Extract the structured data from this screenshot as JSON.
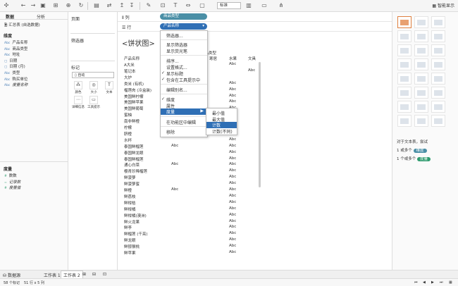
{
  "toolbar": {
    "view_size": "标准",
    "smart_show": "智能显示"
  },
  "left": {
    "tab_data": "数据",
    "tab_analysis": "分析",
    "datasource": "汇总表 (自选数据)",
    "dimensions_header": "维度",
    "dimensions": [
      {
        "type": "Abc",
        "name": "产品名称"
      },
      {
        "type": "Abc",
        "name": "商品类型"
      },
      {
        "type": "Abc",
        "name": "地址"
      },
      {
        "type": "▢",
        "name": "日期"
      },
      {
        "type": "▢",
        "name": "日期 (月)"
      },
      {
        "type": "Abc",
        "name": "类型"
      },
      {
        "type": "Abc",
        "name": "购买单位"
      },
      {
        "type": "Abc",
        "name": "度量名称"
      }
    ],
    "measures_header": "度量",
    "measures": [
      {
        "type": "#",
        "name": "数数"
      },
      {
        "type": "=",
        "name": "记录数"
      },
      {
        "type": "#",
        "name": "度量值"
      }
    ]
  },
  "pages": {
    "pages_label": "页面",
    "filters_label": "筛选器",
    "marks_label": "标记",
    "mark_type": "自动",
    "mark_buttons": [
      "颜色",
      "大小",
      "文本",
      "详细信息",
      "工具提示"
    ]
  },
  "shelves": {
    "columns_label": "列",
    "rows_label": "行",
    "columns_pill": "商品类型",
    "rows_pill": "产品名称"
  },
  "view": {
    "title": "<饼状图>",
    "col_header_group": "商品类型",
    "row_header": "产品名称",
    "col_headers": [
      "寒居",
      "水果",
      "文具"
    ],
    "rows": [
      {
        "name": "A大米",
        "c1": "",
        "c2": "Abc",
        "c3": ""
      },
      {
        "name": "笔记本",
        "c1": "",
        "c2": "",
        "c3": "Abc"
      },
      {
        "name": "大炉",
        "c1": "",
        "c2": "",
        "c3": ""
      },
      {
        "name": "类米 (有机)",
        "c1": "",
        "c2": "Abc",
        "c3": ""
      },
      {
        "name": "榴莲肉 (冷盒装)",
        "c1": "",
        "c2": "Abc",
        "c3": ""
      },
      {
        "name": "美国鲜柠檬",
        "c1": "",
        "c2": "Abc",
        "c3": ""
      },
      {
        "name": "美国鲜苹果",
        "c1": "",
        "c2": "Abc",
        "c3": ""
      },
      {
        "name": "美国鲜葡萄",
        "c1": "",
        "c2": "Abc",
        "c3": ""
      },
      {
        "name": "蜜柚",
        "c1": "",
        "c2": "Abc",
        "c3": ""
      },
      {
        "name": "南非鲜橙",
        "c1": "",
        "c2": "Abc",
        "c3": ""
      },
      {
        "name": "柠檬",
        "c1": "",
        "c2": "Abc",
        "c3": ""
      },
      {
        "name": "脐橙",
        "c1": "",
        "c2": "Abc",
        "c3": ""
      },
      {
        "name": "水杯",
        "c1": "",
        "c2": "Abc",
        "c3": ""
      },
      {
        "name": "泰国鲜榴莲",
        "c1": "Abc",
        "c2": "Abc",
        "c3": ""
      },
      {
        "name": "泰国鲜龙眼",
        "c1": "",
        "c2": "Abc",
        "c3": ""
      },
      {
        "name": "泰国鲜榴莲",
        "c1": "",
        "c2": "Abc",
        "c3": ""
      },
      {
        "name": "通心白菜",
        "c1": "Abc",
        "c2": "Abc",
        "c3": ""
      },
      {
        "name": "樱青珍稀榴莲",
        "c1": "",
        "c2": "Abc",
        "c3": ""
      },
      {
        "name": "鲜菠萝",
        "c1": "",
        "c2": "Abc",
        "c3": ""
      },
      {
        "name": "鲜菠萝蜜",
        "c1": "",
        "c2": "Abc",
        "c3": ""
      },
      {
        "name": "鲜橙",
        "c1": "Abc",
        "c2": "Abc",
        "c3": ""
      },
      {
        "name": "鲜荔枝",
        "c1": "",
        "c2": "Abc",
        "c3": ""
      },
      {
        "name": "鲜柑桔",
        "c1": "",
        "c2": "Abc",
        "c3": ""
      },
      {
        "name": "鲜柑橘",
        "c1": "",
        "c2": "Abc",
        "c3": ""
      },
      {
        "name": "鲜柑橘(澳洲)",
        "c1": "",
        "c2": "Abc",
        "c3": ""
      },
      {
        "name": "鲜火龙果",
        "c1": "",
        "c2": "Abc",
        "c3": ""
      },
      {
        "name": "鲜李",
        "c1": "",
        "c2": "Abc",
        "c3": ""
      },
      {
        "name": "鲜榴莲 (千亮)",
        "c1": "",
        "c2": "Abc",
        "c3": ""
      },
      {
        "name": "鲜龙眼",
        "c1": "",
        "c2": "Abc",
        "c3": ""
      },
      {
        "name": "鲜猕猴桃",
        "c1": "",
        "c2": "Abc",
        "c3": ""
      },
      {
        "name": "鲜苹果",
        "c1": "",
        "c2": "Abc",
        "c3": ""
      }
    ]
  },
  "context_menu": {
    "items": [
      {
        "label": "筛选器...",
        "check": ""
      },
      {
        "label": "显示筛选器",
        "check": ""
      },
      {
        "label": "显示荧光笔",
        "check": ""
      },
      {
        "label": "排序...",
        "check": ""
      },
      {
        "label": "设置格式...",
        "check": ""
      },
      {
        "label": "显示标题",
        "check": "✓"
      },
      {
        "label": "包含在工具提示中",
        "check": "✓"
      },
      {
        "label": "编辑别名...",
        "check": ""
      },
      {
        "label": "维度",
        "check": "✓"
      },
      {
        "label": "属性",
        "check": ""
      },
      {
        "label": "度量",
        "check": "",
        "arrow": "▶"
      },
      {
        "label": "在功能区中编辑",
        "check": ""
      },
      {
        "label": "移除",
        "check": ""
      }
    ],
    "submenu": [
      "最小值",
      "最大值",
      "计数",
      "计数(不同)"
    ]
  },
  "right": {
    "hint_title": "对于文本表，尝试",
    "hint_dim": "1 或多个",
    "hint_dim_badge": "维度",
    "hint_meas": "1 个或多个",
    "hint_meas_badge": "度量"
  },
  "bottom": {
    "datasource_tab": "数据源",
    "sheet1": "工作表 1",
    "sheet2": "工作表 2"
  },
  "status": {
    "marks": "58 个标记",
    "rowscols": "51 行 x 5 列"
  },
  "colors": {
    "accent_blue": "#2f6fb5",
    "dimension_pill": "#4a8fa6",
    "measure_pill": "#2e9b6e"
  }
}
